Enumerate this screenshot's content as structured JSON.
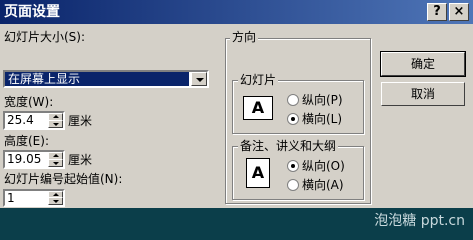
{
  "window": {
    "title": "页面设置",
    "help_btn": "?",
    "close_btn": "×"
  },
  "slide_size": {
    "label": "幻灯片大小(S):",
    "value": "在屏幕上显示"
  },
  "width": {
    "label": "宽度(W):",
    "value": "25.4",
    "unit": "厘米"
  },
  "height": {
    "label": "高度(E):",
    "value": "19.05",
    "unit": "厘米"
  },
  "start_number": {
    "label": "幻灯片编号起始值(N):",
    "value": "1"
  },
  "orientation": {
    "group_label": "方向",
    "slides": {
      "group_label": "幻灯片",
      "icon_letter": "A",
      "portrait": "纵向(P)",
      "landscape": "横向(L)",
      "selected": "landscape"
    },
    "notes": {
      "group_label": "备注、讲义和大纲",
      "icon_letter": "A",
      "portrait": "纵向(O)",
      "landscape": "横向(A)",
      "selected": "portrait"
    }
  },
  "buttons": {
    "ok": "确定",
    "cancel": "取消"
  },
  "watermark": "泡泡糖 ppt.cn"
}
